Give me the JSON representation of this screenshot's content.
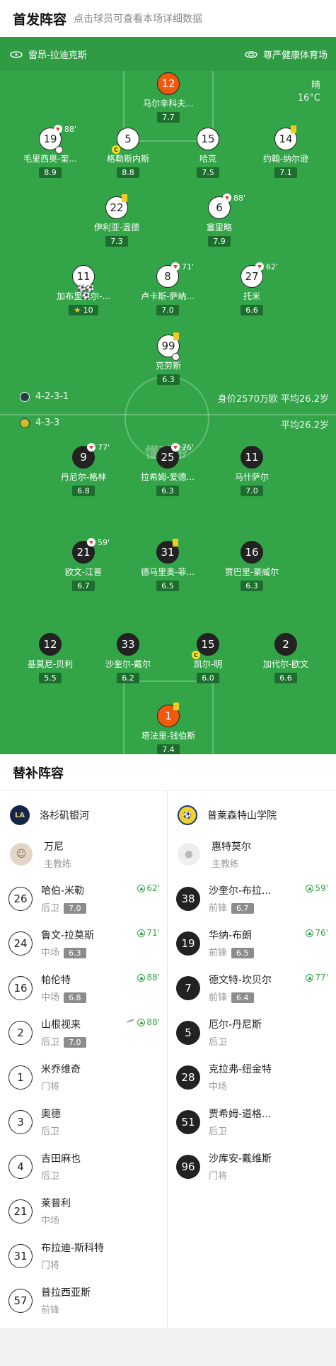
{
  "header": {
    "title": "首发阵容",
    "subtitle": "点击球员可查看本场详细数据"
  },
  "pitch": {
    "stadium": "雷昂-拉迪克斯",
    "sponsor": "尊严健康体育场",
    "weather": "晴",
    "temperature": "16°C",
    "watermark": "懂球帝",
    "home_formation": "4-2-3-1",
    "home_info": "身价2570万欧 平均26.2岁",
    "away_formation": "4-3-3",
    "away_info": "平均26.2岁"
  },
  "home_players": [
    {
      "num": "12",
      "name": "马尔辛科夫...",
      "rating": "7.7"
    },
    {
      "num": "19",
      "name": "毛里西奥-奎...",
      "rating": "8.9",
      "sub_min": "88'"
    },
    {
      "num": "5",
      "name": "格勒斯内斯",
      "rating": "8.8"
    },
    {
      "num": "15",
      "name": "哈克",
      "rating": "7.5"
    },
    {
      "num": "14",
      "name": "约翰-纳尔逊",
      "rating": "7.1"
    },
    {
      "num": "22",
      "name": "伊利亚-温德",
      "rating": "7.3"
    },
    {
      "num": "6",
      "name": "塞里略",
      "rating": "7.9",
      "sub_min": "88'"
    },
    {
      "num": "11",
      "name": "加布里埃尔-...",
      "rating": "10",
      "goals": "⚽⚽⚽"
    },
    {
      "num": "8",
      "name": "卢卡斯-萨纳...",
      "rating": "7.0",
      "sub_min": "71'"
    },
    {
      "num": "27",
      "name": "托米",
      "rating": "6.6",
      "sub_min": "62'"
    },
    {
      "num": "99",
      "name": "克劳斯",
      "rating": "6.3"
    }
  ],
  "away_players": [
    {
      "num": "9",
      "name": "丹尼尔-格林",
      "rating": "6.8",
      "sub_min": "77'"
    },
    {
      "num": "25",
      "name": "拉希姆-爱德...",
      "rating": "6.3",
      "sub_min": "76'"
    },
    {
      "num": "11",
      "name": "马什萨尔",
      "rating": "7.0"
    },
    {
      "num": "21",
      "name": "欧文-江普",
      "rating": "6.7",
      "sub_min": "59'"
    },
    {
      "num": "31",
      "name": "德马里奥-菲...",
      "rating": "6.5"
    },
    {
      "num": "16",
      "name": "贾巴里-豪威尔",
      "rating": "6.3"
    },
    {
      "num": "12",
      "name": "基莫尼-贝利",
      "rating": "5.5"
    },
    {
      "num": "33",
      "name": "沙奎尔-戴尔",
      "rating": "6.2"
    },
    {
      "num": "15",
      "name": "凯尔-明",
      "rating": "6.0"
    },
    {
      "num": "2",
      "name": "加代尔-欧文",
      "rating": "6.6"
    },
    {
      "num": "1",
      "name": "塔法里-钱伯斯",
      "rating": "7.4"
    }
  ],
  "subs": {
    "title": "替补阵容",
    "home_team": "洛杉矶银河",
    "away_team": "普莱森特山学院",
    "home_logo": "LA",
    "home_coach": {
      "name": "万尼",
      "role": "主教练"
    },
    "away_coach": {
      "name": "惠特莫尔",
      "role": "主教练"
    },
    "home": [
      {
        "num": "26",
        "name": "哈伯-米勒",
        "pos": "后卫",
        "rating": "7.0",
        "in": "62'"
      },
      {
        "num": "24",
        "name": "鲁文-拉莫斯",
        "pos": "中场",
        "rating": "6.3",
        "in": "71'"
      },
      {
        "num": "16",
        "name": "帕伦特",
        "pos": "中场",
        "rating": "6.8",
        "in": "88'"
      },
      {
        "num": "2",
        "name": "山根视来",
        "pos": "后卫",
        "rating": "7.0",
        "in": "88'"
      },
      {
        "num": "1",
        "name": "米乔维奇",
        "pos": "门将"
      },
      {
        "num": "3",
        "name": "奥德",
        "pos": "后卫"
      },
      {
        "num": "4",
        "name": "吉田麻也",
        "pos": "后卫"
      },
      {
        "num": "21",
        "name": "莱普利",
        "pos": "中场"
      },
      {
        "num": "31",
        "name": "布拉迪-斯科特",
        "pos": "门将"
      },
      {
        "num": "57",
        "name": "普拉西亚斯",
        "pos": "前锋"
      }
    ],
    "away": [
      {
        "num": "38",
        "name": "沙奎尔-布拉...",
        "pos": "前锋",
        "rating": "6.7",
        "in": "59'"
      },
      {
        "num": "19",
        "name": "华纳-布朗",
        "pos": "前锋",
        "rating": "6.5",
        "in": "76'"
      },
      {
        "num": "7",
        "name": "德文特-坎贝尔",
        "pos": "前锋",
        "rating": "6.4",
        "in": "77'"
      },
      {
        "num": "5",
        "name": "厄尔-丹尼斯",
        "pos": "后卫"
      },
      {
        "num": "28",
        "name": "克拉弗-纽金特",
        "pos": "中场"
      },
      {
        "num": "51",
        "name": "贾希姆-道格...",
        "pos": "后卫"
      },
      {
        "num": "96",
        "name": "沙库安-戴维斯",
        "pos": "门将"
      }
    ]
  },
  "colors": {
    "pitch": "#33a548",
    "gk": "#f05a0e",
    "yellow_card": "#f3cb1e"
  }
}
